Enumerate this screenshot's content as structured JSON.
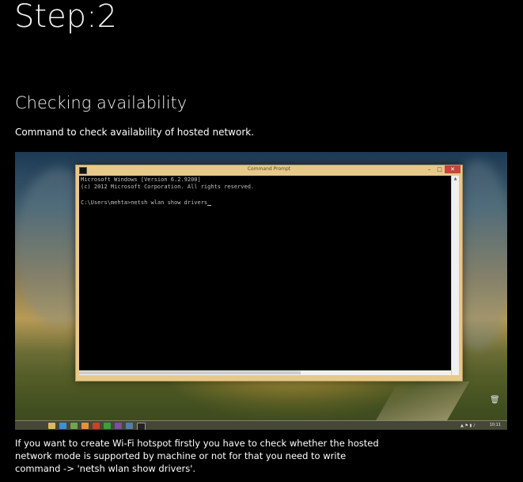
{
  "page": {
    "step_title": "Step:2",
    "section_heading": "Checking availability",
    "intro_text": "Command to check availability of hosted network.",
    "bottom_text": "If you want to create Wi-Fi hotspot firstly you have to check whether the hosted network mode is supported by machine or not for that you need to write command -> 'netsh wlan show drivers'."
  },
  "cmd_window": {
    "title": "Command Prompt",
    "minimize_icon": "minimize-icon",
    "maximize_icon": "maximize-icon",
    "close_icon": "close-icon",
    "lines": [
      "Microsoft Windows [Version 6.2.9200]",
      "(c) 2012 Microsoft Corporation. All rights reserved.",
      "",
      "C:\\Users\\mehta>netsh wlan show drivers"
    ]
  },
  "taskbar": {
    "clock": "10:11",
    "icons": [
      "file-explorer-icon",
      "ie-icon",
      "media-icon",
      "app-icon",
      "store-icon",
      "chat-icon",
      "vs-icon",
      "settings-icon",
      "cmd-icon"
    ]
  },
  "colors": {
    "background": "#000000",
    "text": "#ffffff",
    "cmd_border": "#e7c98a",
    "close_button": "#c7453a"
  }
}
